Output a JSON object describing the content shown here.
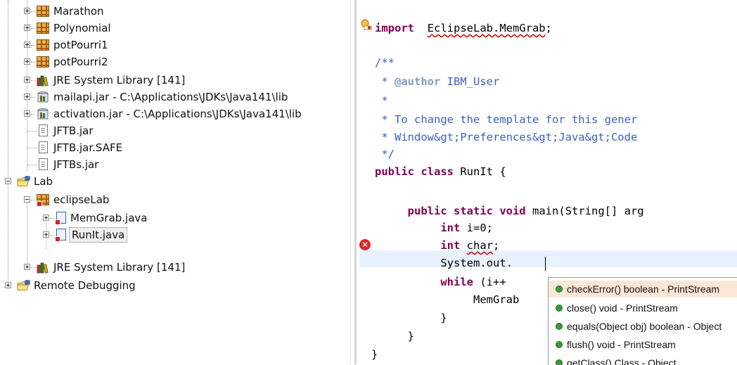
{
  "tree": {
    "items": [
      {
        "label": "Marathon"
      },
      {
        "label": "Polynomial"
      },
      {
        "label": "potPourri1"
      },
      {
        "label": "potPourri2"
      },
      {
        "label": "JRE System Library [141]"
      },
      {
        "label": "mailapi.jar - C:\\Applications\\JDKs\\Java141\\lib"
      },
      {
        "label": "activation.jar - C:\\Applications\\JDKs\\Java141\\lib"
      },
      {
        "label": "JFTB.jar"
      },
      {
        "label": "JFTB.jar.SAFE"
      },
      {
        "label": "JFTBs.jar"
      },
      {
        "label": "Lab"
      },
      {
        "label": "eclipseLab"
      },
      {
        "label": "MemGrab.java"
      },
      {
        "label": "RunIt.java"
      },
      {
        "label": "JRE System Library [141]"
      },
      {
        "label": "Remote Debugging"
      }
    ]
  },
  "editor": {
    "import_kw": "import",
    "import_name": "EclipseLab.MemGrab",
    "import_semi": ";",
    "doc_open": "/**",
    "doc_author_tag": "@author",
    "doc_author_name": "IBM_User",
    "doc_star": "*",
    "doc_line4": "* To change the template for this gener",
    "doc_line5": "* Window&gt;Preferences&gt;Java&gt;Code",
    "doc_close": "*/",
    "class_kw": "public class",
    "class_name": "RunIt {",
    "main_kw": "public static void",
    "main_rest": "main(String[] arg",
    "int_kw": "int",
    "line_i": "i=0;",
    "line_char_name": "char",
    "line_char_semi": ";",
    "line_sysout": "System.out.",
    "while_kw": "while",
    "while_rest": "(i++",
    "memgrab": "MemGrab",
    "brace_close": "}",
    "error_glyph": "✕"
  },
  "completion": {
    "items": [
      {
        "text": "checkError()  boolean - PrintStream",
        "selected": true
      },
      {
        "text": "close()  void - PrintStream",
        "selected": false
      },
      {
        "text": "equals(Object obj)  boolean - Object",
        "selected": false
      },
      {
        "text": "flush()  void - PrintStream",
        "selected": false
      },
      {
        "text": "getClass()  Class - Object",
        "selected": false
      }
    ]
  }
}
